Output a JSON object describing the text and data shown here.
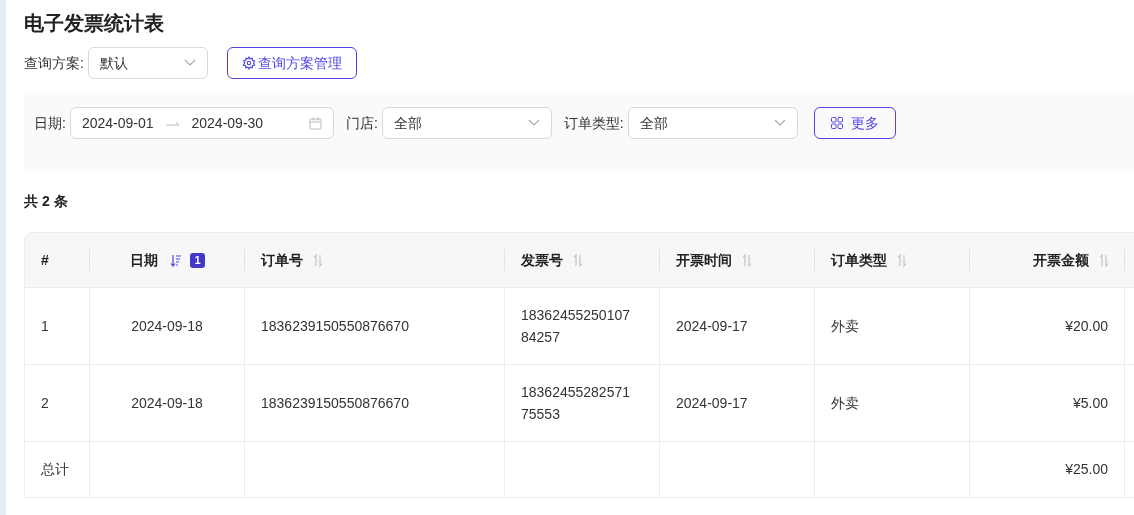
{
  "title": "电子发票统计表",
  "scheme": {
    "label": "查询方案:",
    "value": "默认",
    "manage_button": "查询方案管理"
  },
  "filters": {
    "date_label": "日期:",
    "date_start": "2024-09-01",
    "date_end": "2024-09-30",
    "store_label": "门店:",
    "store_value": "全部",
    "order_type_label": "订单类型:",
    "order_type_value": "全部",
    "more_button": "更多"
  },
  "count": "共 2 条",
  "table": {
    "columns": [
      {
        "label": "#"
      },
      {
        "label": "日期",
        "sorted": true,
        "sort_badge": "1"
      },
      {
        "label": "订单号",
        "sorted": false
      },
      {
        "label": "发票号",
        "sorted": false
      },
      {
        "label": "开票时间",
        "sorted": false
      },
      {
        "label": "订单类型",
        "sorted": false
      },
      {
        "label": "开票金额",
        "sorted": false
      }
    ],
    "rows": [
      [
        "1",
        "2024-09-18",
        "1836239150550876670",
        "1836245525010784257",
        "2024-09-17",
        "外卖",
        "¥20.00"
      ],
      [
        "2",
        "2024-09-18",
        "1836239150550876670",
        "1836245528257175553",
        "2024-09-17",
        "外卖",
        "¥5.00"
      ]
    ],
    "total_row": {
      "label": "总计",
      "amount": "¥25.00"
    }
  }
}
